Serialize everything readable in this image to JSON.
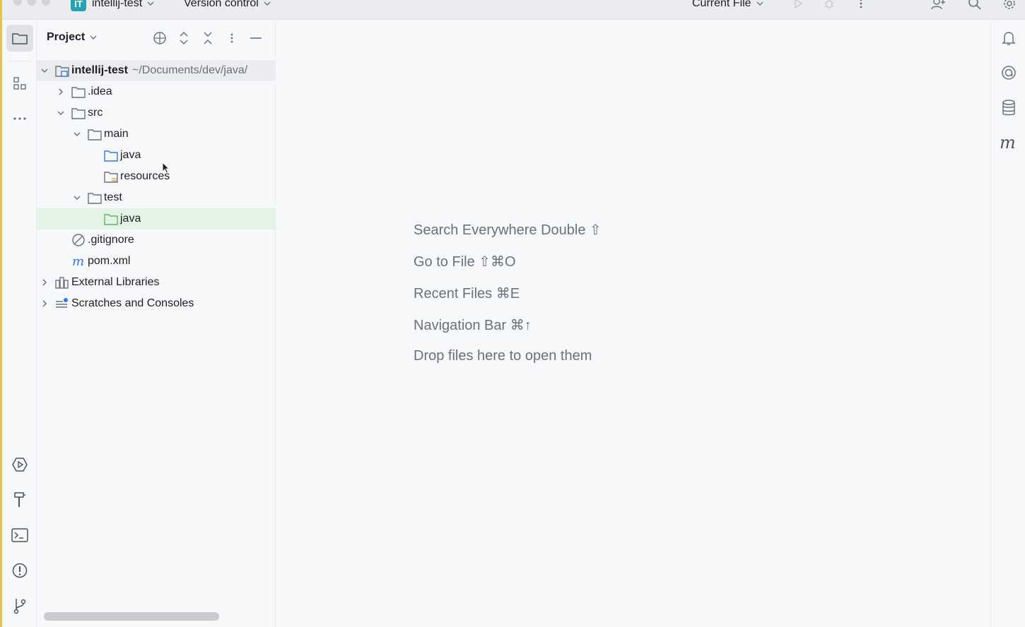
{
  "titlebar": {
    "project_badge": "IT",
    "project_name": "intellij-test",
    "vcs_label": "Version control",
    "run_config": "Current File",
    "icons": [
      "run-icon",
      "debug-icon",
      "more-vertical-icon",
      "add-user-icon",
      "search-icon",
      "settings-icon"
    ]
  },
  "left_strip": {
    "top": [
      "folder-icon",
      "structure-icon",
      "more-horizontal-icon"
    ],
    "bottom": [
      "services-icon",
      "build-icon",
      "terminal-icon",
      "problems-icon",
      "git-branch-icon"
    ]
  },
  "project_panel": {
    "title": "Project",
    "header_icons": [
      "locate-icon",
      "expand-all-icon",
      "collapse-all-icon",
      "options-icon",
      "hide-icon"
    ],
    "tree": [
      {
        "label": "intellij-test",
        "hint": "~/Documents/dev/java/",
        "icon": "module-folder-icon",
        "expanded": true
      },
      {
        "label": ".idea",
        "icon": "folder-icon",
        "expanded": false
      },
      {
        "label": "src",
        "icon": "folder-icon",
        "expanded": true
      },
      {
        "label": "main",
        "icon": "folder-icon",
        "expanded": true
      },
      {
        "label": "java",
        "icon": "source-folder-icon"
      },
      {
        "label": "resources",
        "icon": "resources-folder-icon"
      },
      {
        "label": "test",
        "icon": "folder-icon",
        "expanded": true
      },
      {
        "label": "java",
        "icon": "test-source-folder-icon",
        "selected": true
      },
      {
        "label": ".gitignore",
        "icon": "ignore-file-icon"
      },
      {
        "label": "pom.xml",
        "icon": "maven-icon"
      },
      {
        "label": "External Libraries",
        "icon": "libraries-icon",
        "expanded": false
      },
      {
        "label": "Scratches and Consoles",
        "icon": "scratches-icon",
        "expanded": false
      }
    ]
  },
  "editor": {
    "hints": [
      "Search Everywhere Double ⇧",
      "Go to File ⇧⌘O",
      "Recent Files ⌘E",
      "Navigation Bar ⌘↑",
      "Drop files here to open them"
    ]
  },
  "right_strip": [
    "notifications-icon",
    "ai-assistant-icon",
    "database-icon",
    "maven-tool-icon"
  ],
  "colors": {
    "accent_teal": "#24a3b0",
    "selection_green": "#e3f3e6",
    "source_folder_blue": "#3574f0",
    "resources_orange": "#e5a445",
    "test_green": "#5fb865",
    "background": "#f7f8fa"
  }
}
